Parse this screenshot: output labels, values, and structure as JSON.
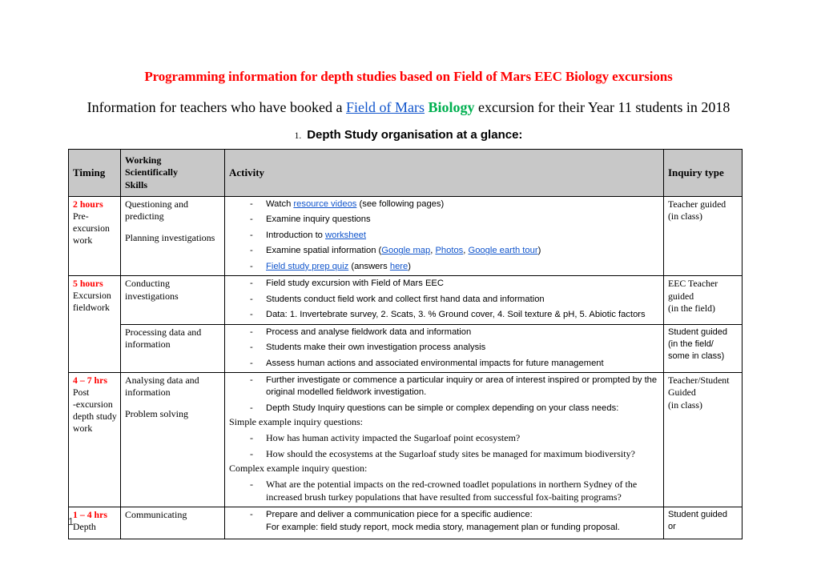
{
  "document": {
    "title": "Programming information for depth studies based on Field of Mars EEC Biology excursions",
    "subtitle_part1": "Information for teachers who have booked a ",
    "subtitle_link": "Field of Mars",
    "subtitle_space1": " ",
    "subtitle_green": "Biology",
    "subtitle_part2": " excursion for their Year 11 students in 2018",
    "section_number": "1.",
    "section_heading": "Depth Study organisation at a glance:",
    "page_number": "1",
    "colors": {
      "title_red": "#ff0000",
      "link_blue": "#1155cc",
      "green": "#00b050",
      "header_gray": "#c8c8c8"
    }
  },
  "table": {
    "headers": {
      "timing": "Timing",
      "working_scientifically": "Working Scientifically Skills",
      "working_scientifically_lines": [
        "Working",
        "Scientifically",
        "Skills"
      ],
      "activity": "Activity",
      "inquiry_type": "Inquiry type"
    },
    "rows": [
      {
        "timing_hours": "2 hours",
        "timing_sub_lines": [
          "Pre-",
          "excursion",
          "work"
        ],
        "wss_lines": [
          "Questioning and",
          "predicting",
          "",
          "Planning investigations"
        ],
        "activity_items": [
          {
            "segments": [
              {
                "text": "Watch ",
                "type": "plain"
              },
              {
                "text": "resource videos",
                "type": "link"
              },
              {
                "text": " (see following pages)",
                "type": "plain"
              }
            ]
          },
          {
            "segments": [
              {
                "text": "Examine inquiry questions",
                "type": "plain"
              }
            ]
          },
          {
            "segments": [
              {
                "text": "Introduction to ",
                "type": "plain"
              },
              {
                "text": "worksheet",
                "type": "link"
              }
            ]
          },
          {
            "segments": [
              {
                "text": "Examine spatial information (",
                "type": "plain"
              },
              {
                "text": "Google map",
                "type": "link"
              },
              {
                "text": ", ",
                "type": "plain"
              },
              {
                "text": "Photos",
                "type": "link"
              },
              {
                "text": ", ",
                "type": "plain"
              },
              {
                "text": "Google earth tour",
                "type": "link"
              },
              {
                "text": ")",
                "type": "plain"
              }
            ]
          },
          {
            "segments": [
              {
                "text": "Field study prep quiz",
                "type": "link"
              },
              {
                "text": " (answers ",
                "type": "plain"
              },
              {
                "text": "here",
                "type": "link"
              },
              {
                "text": ")",
                "type": "plain"
              }
            ]
          }
        ],
        "inquiry_lines": [
          "Teacher guided",
          "(in class)"
        ]
      },
      {
        "timing_hours": "5 hours",
        "timing_sub_lines": [
          "Excursion",
          "fieldwork"
        ],
        "wss_lines": [
          "Conducting",
          "investigations"
        ],
        "activity_items": [
          {
            "segments": [
              {
                "text": "Field study excursion with Field of Mars EEC",
                "type": "plain"
              }
            ]
          },
          {
            "segments": [
              {
                "text": "Students conduct field work and collect first hand data and information",
                "type": "plain"
              }
            ]
          },
          {
            "segments": [
              {
                "text": "Data: 1. Invertebrate survey, 2. Scats, 3. % Ground cover, 4. Soil texture & pH, 5. Abiotic factors",
                "type": "plain"
              }
            ]
          }
        ],
        "inquiry_lines": [
          "EEC Teacher",
          "guided",
          "(in the field)"
        ]
      },
      {
        "timing_hours": "",
        "timing_sub_lines": [],
        "wss_lines": [
          "Processing data and",
          "information"
        ],
        "activity_items": [
          {
            "segments": [
              {
                "text": "Process and analyse fieldwork data and information",
                "type": "plain"
              }
            ]
          },
          {
            "segments": [
              {
                "text": "Students make their own investigation process analysis",
                "type": "plain"
              }
            ]
          },
          {
            "segments": [
              {
                "text": "Assess human actions and associated environmental impacts for future management",
                "type": "plain"
              }
            ]
          }
        ],
        "inquiry_lines": [
          "Student guided",
          "(in the field/",
          "some in class)"
        ]
      },
      {
        "timing_hours": "4 – 7 hrs",
        "timing_sub_lines": [
          "Post",
          "-excursion",
          "depth study",
          "work"
        ],
        "wss_lines": [
          "Analysing data and",
          "information",
          "",
          "Problem solving"
        ],
        "activity_items": [
          {
            "segments": [
              {
                "text": "Further investigate or commence a particular inquiry or area of interest inspired or prompted by the original modelled fieldwork investigation.",
                "type": "plain"
              }
            ]
          },
          {
            "segments": [
              {
                "text": "Depth Study Inquiry questions can be simple or complex depending on your class needs:",
                "type": "plain"
              }
            ]
          }
        ],
        "activity_plain_1": "Simple example inquiry questions:",
        "activity_items_2": [
          {
            "segments": [
              {
                "text": "How has human activity impacted the Sugarloaf point ecosystem?",
                "type": "plain"
              }
            ]
          },
          {
            "segments": [
              {
                "text": "How should the ecosystems at the Sugarloaf study sites be managed for maximum biodiversity?",
                "type": "plain"
              }
            ]
          }
        ],
        "activity_plain_2": "Complex example inquiry question:",
        "activity_items_3": [
          {
            "segments": [
              {
                "text": "What are the potential impacts on the red-crowned toadlet populations in northern Sydney of the increased brush turkey populations that have resulted from successful fox-baiting programs?",
                "type": "plain"
              }
            ]
          }
        ],
        "inquiry_lines": [
          "Teacher/Student",
          "Guided",
          "(in class)"
        ]
      },
      {
        "timing_hours": "1 – 4 hrs",
        "timing_sub_lines": [
          "Depth"
        ],
        "wss_lines": [
          "Communicating"
        ],
        "activity_items": [
          {
            "segments": [
              {
                "text": "Prepare and deliver a communication piece for a specific audience:",
                "type": "plain"
              }
            ]
          }
        ],
        "activity_cont": "For example: field study report, mock media story, management plan or funding proposal.",
        "inquiry_lines": [
          "Student guided",
          "or"
        ]
      }
    ]
  }
}
